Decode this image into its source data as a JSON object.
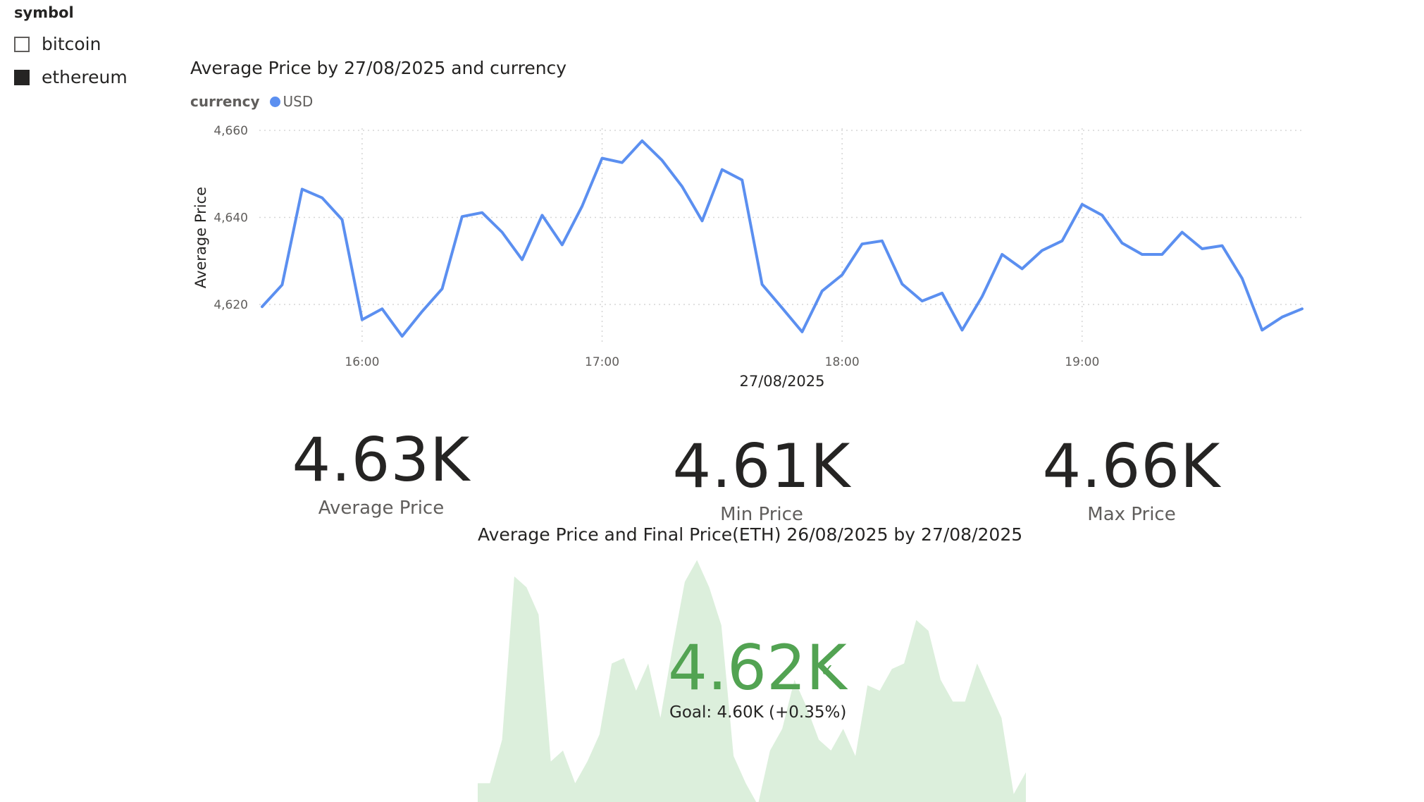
{
  "slicer": {
    "title": "symbol",
    "items": [
      {
        "label": "bitcoin",
        "checked": false
      },
      {
        "label": "ethereum",
        "checked": true
      }
    ]
  },
  "line_chart": {
    "title": "Average Price by 27/08/2025 and currency",
    "legend_title": "currency",
    "legend_series": "USD",
    "series_color": "#5b8ff0"
  },
  "cards": [
    {
      "value": "4.63K",
      "label": "Average Price"
    },
    {
      "value": "4.61K",
      "label": "Min Price"
    },
    {
      "value": "4.66K",
      "label": "Max Price"
    }
  ],
  "kpi": {
    "title": "Average Price and Final Price(ETH) 26/08/2025 by 27/08/2025",
    "value": "4.62K",
    "status_icon": "check-icon",
    "goal_text": "Goal: 4.60K (+0.35%)",
    "value_color": "#52a352",
    "area_color": "#dcefdc"
  },
  "chart_data": [
    {
      "type": "line",
      "title": "Average Price by 27/08/2025 and currency",
      "xlabel": "27/08/2025",
      "ylabel": "Average Price",
      "x_ticks": [
        "16:00",
        "17:00",
        "18:00",
        "19:00"
      ],
      "y_ticks": [
        "4,620",
        "4,640",
        "4,660"
      ],
      "ylim": [
        4610,
        4660
      ],
      "grid": true,
      "legend_title": "currency",
      "legend_position": "top-left",
      "series": [
        {
          "name": "USD",
          "x": [
            "15:35",
            "15:40",
            "15:45",
            "15:50",
            "15:55",
            "16:00",
            "16:05",
            "16:10",
            "16:15",
            "16:20",
            "16:25",
            "16:30",
            "16:35",
            "16:40",
            "16:45",
            "16:50",
            "16:55",
            "17:00",
            "17:05",
            "17:10",
            "17:15",
            "17:20",
            "17:25",
            "17:30",
            "17:35",
            "17:40",
            "17:45",
            "17:50",
            "17:55",
            "18:00",
            "18:05",
            "18:10",
            "18:15",
            "18:20",
            "18:25",
            "18:30",
            "18:35",
            "18:40",
            "18:45",
            "18:50",
            "18:55",
            "19:00",
            "19:05",
            "19:10",
            "19:15",
            "19:20",
            "19:25",
            "19:30",
            "19:35",
            "19:40",
            "19:45",
            "19:50",
            "19:55"
          ],
          "values": [
            4619.5,
            4624.5,
            4646.5,
            4644.5,
            4639.5,
            4616.5,
            4619.0,
            4612.7,
            4618.4,
            4623.6,
            4640.2,
            4641.1,
            4636.6,
            4630.3,
            4640.5,
            4633.7,
            4642.6,
            4653.6,
            4652.6,
            4657.6,
            4653.1,
            4647.1,
            4639.2,
            4651.0,
            4648.6,
            4624.6,
            4619.2,
            4613.7,
            4623.1,
            4626.8,
            4633.9,
            4634.6,
            4624.7,
            4620.8,
            4622.6,
            4614.1,
            4621.8,
            4631.5,
            4628.2,
            4632.4,
            4634.6,
            4643.0,
            4640.5,
            4634.1,
            4631.5,
            4631.5,
            4636.6,
            4632.8,
            4633.5,
            4626.0,
            4614.1,
            4617.1,
            4619.0
          ]
        }
      ]
    },
    {
      "type": "area",
      "title": "Average Price and Final Price(ETH) 26/08/2025 by 27/08/2025",
      "value_label": "4.62K",
      "goal_label": "Goal: 4.60K (+0.35%)",
      "series": [
        {
          "values": [
            4608,
            4608,
            4616,
            4646,
            4644,
            4639,
            4612,
            4614,
            4608,
            4612,
            4617,
            4630,
            4631,
            4625,
            4630,
            4620,
            4633,
            4645,
            4649,
            4644,
            4637,
            4613,
            4608,
            4604,
            4614,
            4618,
            4627,
            4622,
            4616,
            4614,
            4618,
            4613,
            4626,
            4625,
            4629,
            4630,
            4638,
            4636,
            4627,
            4623,
            4623,
            4630,
            4625,
            4620,
            4606,
            4610
          ]
        }
      ]
    }
  ]
}
